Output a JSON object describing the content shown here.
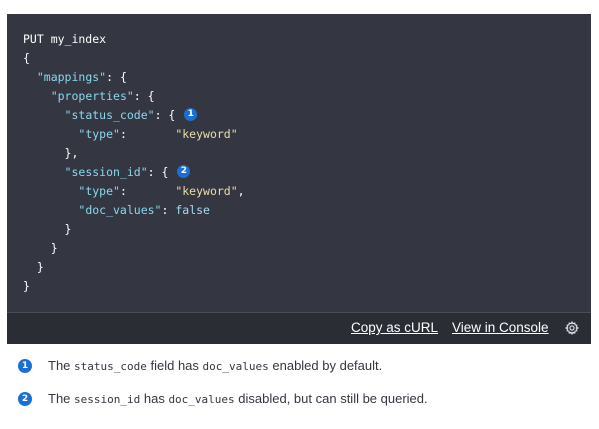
{
  "code": {
    "request_line": "PUT my_index",
    "open_brace": "{",
    "mappings_key": "\"mappings\"",
    "mappings_punct": ": {",
    "properties_key": "\"properties\"",
    "properties_punct": ": {",
    "status_code_key": "\"status_code\"",
    "status_code_punct": ": {",
    "status_code_callout": "1",
    "type_key_1": "\"type\"",
    "type_sep_1": ":       ",
    "type_val_1": "\"keyword\"",
    "close_status": "},",
    "session_id_key": "\"session_id\"",
    "session_id_punct": ": {",
    "session_id_callout": "2",
    "type_key_2": "\"type\"",
    "type_sep_2": ":       ",
    "type_val_2": "\"keyword\"",
    "type_comma_2": ",",
    "doc_values_key": "\"doc_values\"",
    "doc_values_sep": ": ",
    "doc_values_val": "false",
    "close_session": "}",
    "close_properties": "}",
    "close_mappings": "}",
    "close_root": "}"
  },
  "footer": {
    "copy_curl_label": "Copy as cURL",
    "view_console_label": "View in Console",
    "settings_icon": "gear-icon"
  },
  "notes": [
    {
      "badge": "1",
      "prefix": "The ",
      "code1": "status_code",
      "middle": " field has ",
      "code2": "doc_values",
      "suffix": " enabled by default."
    },
    {
      "badge": "2",
      "prefix": "The ",
      "code1": "session_id",
      "middle": " has ",
      "code2": "doc_values",
      "suffix": " disabled, but can still be queried."
    }
  ],
  "colors": {
    "panel_bg": "#343741",
    "key": "#8ad7ef",
    "string": "#eaddab",
    "callout": "#1b6fd4"
  }
}
